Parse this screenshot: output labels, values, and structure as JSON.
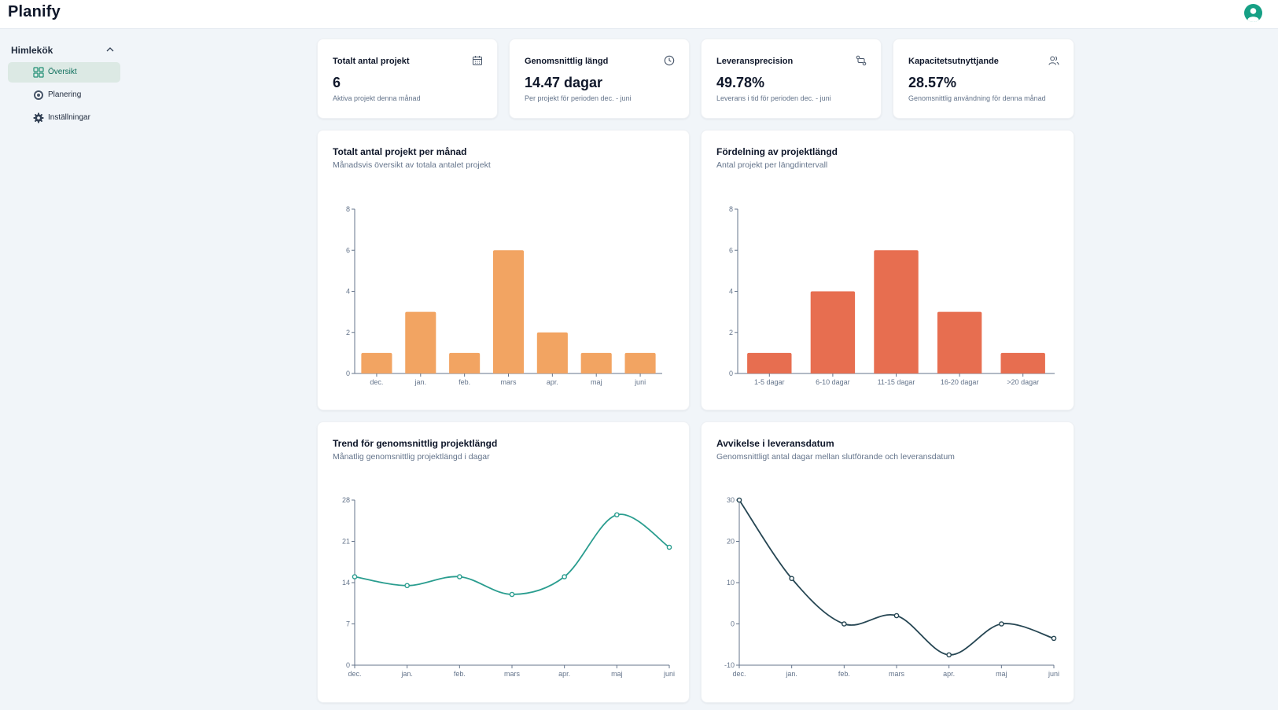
{
  "app": {
    "title": "Planify"
  },
  "user": {
    "avatar_icon": "user-circle-icon",
    "color": "#16a085"
  },
  "sidebar": {
    "group_label": "Himlekök",
    "items": [
      {
        "label": "Översikt",
        "icon": "dashboard-grid-icon",
        "active": true
      },
      {
        "label": "Planering",
        "icon": "target-icon",
        "active": false
      },
      {
        "label": "Inställningar",
        "icon": "gear-icon",
        "active": false
      }
    ]
  },
  "stats": [
    {
      "title": "Totalt antal projekt",
      "value": "6",
      "sub": "Aktiva projekt denna månad",
      "icon": "calendar-icon"
    },
    {
      "title": "Genomsnittlig längd",
      "value": "14.47 dagar",
      "sub": "Per projekt för perioden dec. - juni",
      "icon": "clock-icon"
    },
    {
      "title": "Leveransprecision",
      "value": "49.78%",
      "sub": "Leverans i tid för perioden dec. - juni",
      "icon": "route-icon"
    },
    {
      "title": "Kapacitetsutnyttjande",
      "value": "28.57%",
      "sub": "Genomsnittlig användning för denna månad",
      "icon": "users-icon"
    }
  ],
  "charts": {
    "projects_per_month": {
      "title": "Totalt antal projekt per månad",
      "subtitle": "Månadsvis översikt av totala antalet projekt"
    },
    "length_distribution": {
      "title": "Fördelning av projektlängd",
      "subtitle": "Antal projekt per längdintervall"
    },
    "length_trend": {
      "title": "Trend för genomsnittlig projektlängd",
      "subtitle": "Månatlig genomsnittlig projektlängd i dagar"
    },
    "delivery_deviation": {
      "title": "Avvikelse i leveransdatum",
      "subtitle": "Genomsnittligt antal dagar mellan slutförande och leveransdatum"
    }
  },
  "chart_data": [
    {
      "type": "bar",
      "categories": [
        "dec.",
        "jan.",
        "feb.",
        "mars",
        "apr.",
        "maj",
        "juni"
      ],
      "values": [
        1,
        3,
        1,
        6,
        2,
        1,
        1
      ],
      "title": "Totalt antal projekt per månad",
      "subtitle": "Månadsvis översikt av totala antalet projekt",
      "ylim": [
        0,
        8
      ],
      "yticks": [
        0,
        2,
        4,
        6,
        8
      ],
      "color": "#f2a462",
      "grid": false
    },
    {
      "type": "bar",
      "categories": [
        "1-5 dagar",
        "6-10 dagar",
        "11-15 dagar",
        "16-20 dagar",
        ">20 dagar"
      ],
      "values": [
        1,
        4,
        6,
        3,
        1
      ],
      "title": "Fördelning av projektlängd",
      "subtitle": "Antal projekt per längdintervall",
      "ylim": [
        0,
        8
      ],
      "yticks": [
        0,
        2,
        4,
        6,
        8
      ],
      "color": "#e76e50",
      "grid": false
    },
    {
      "type": "line",
      "categories": [
        "dec.",
        "jan.",
        "feb.",
        "mars",
        "apr.",
        "maj",
        "juni"
      ],
      "values": [
        15,
        13.5,
        15,
        12,
        15,
        25.5,
        20
      ],
      "title": "Trend för genomsnittlig projektlängd",
      "subtitle": "Månatlig genomsnittlig projektlängd i dagar",
      "ylim": [
        0,
        28
      ],
      "yticks": [
        0,
        7,
        14,
        21,
        28
      ],
      "color": "#2a9d8f",
      "grid": false
    },
    {
      "type": "line",
      "categories": [
        "dec.",
        "jan.",
        "feb.",
        "mars",
        "apr.",
        "maj",
        "juni"
      ],
      "values": [
        30,
        11,
        0,
        2,
        -7.5,
        0,
        -3.5
      ],
      "title": "Avvikelse i leveransdatum",
      "subtitle": "Genomsnittligt antal dagar mellan slutförande och leveransdatum",
      "ylim": [
        -10,
        30
      ],
      "yticks": [
        -10,
        0,
        10,
        20,
        30
      ],
      "color": "#264653",
      "grid": false
    }
  ]
}
